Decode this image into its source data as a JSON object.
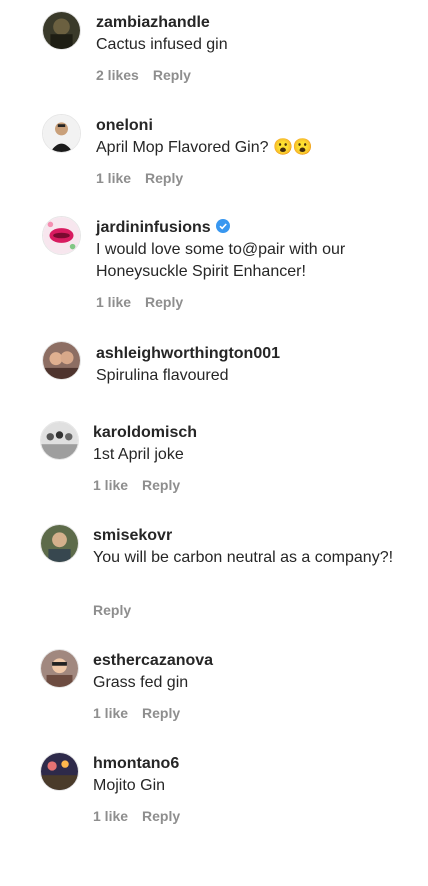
{
  "comments": [
    {
      "username": "zambiazhandle",
      "text": "Cactus infused gin",
      "likes": "2 likes",
      "reply": "Reply",
      "verified": false
    },
    {
      "username": "oneloni",
      "text": "April Mop Flavored Gin? 😮😮",
      "likes": "1 like",
      "reply": "Reply",
      "verified": false
    },
    {
      "username": "jardininfusions",
      "text": "I would love some to@pair with our Honeysuckle Spirit Enhancer!",
      "likes": "1 like",
      "reply": "Reply",
      "verified": true
    },
    {
      "username": "ashleighworthington001",
      "text": "Spirulina flavoured",
      "likes": "",
      "reply": "",
      "verified": false
    },
    {
      "username": "karoldomisch",
      "text": "1st April joke",
      "likes": "1 like",
      "reply": "Reply",
      "verified": false
    },
    {
      "username": "smisekovr",
      "text": "You will be carbon neutral as a company?!",
      "likes": "",
      "reply": "Reply",
      "verified": false
    },
    {
      "username": "esthercazanova",
      "text": "Grass fed gin",
      "likes": "1 like",
      "reply": "Reply",
      "verified": false
    },
    {
      "username": "hmontano6",
      "text": "Mojito Gin",
      "likes": "1 like",
      "reply": "Reply",
      "verified": false
    }
  ],
  "colors": {
    "verified": "#3897f0",
    "meta": "#8e8e8e",
    "text": "#262626"
  }
}
